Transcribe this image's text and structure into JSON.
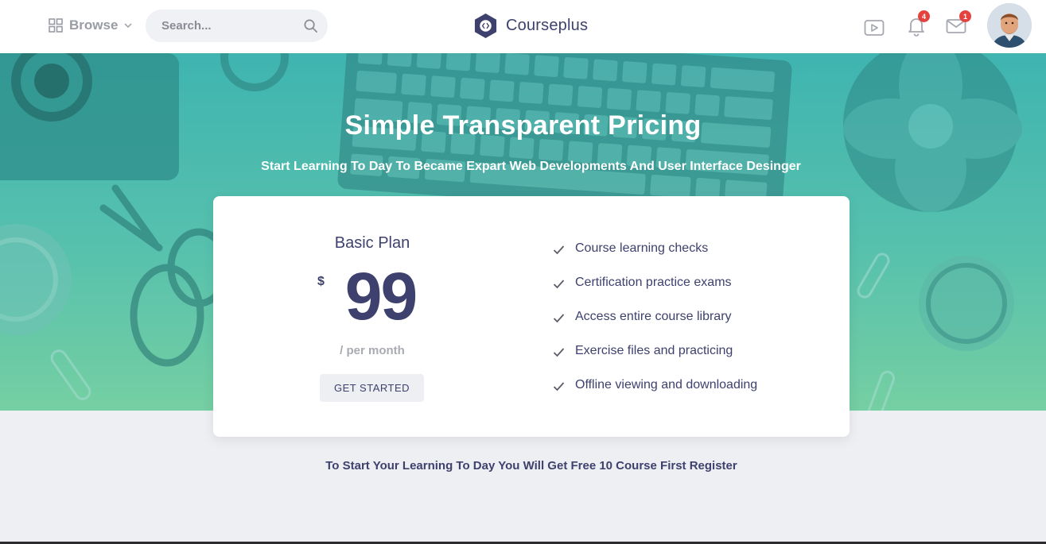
{
  "header": {
    "browse_label": "Browse",
    "search_placeholder": "Search...",
    "brand": "Courseplus",
    "notifications_count": "4",
    "messages_count": "1",
    "icons": [
      "grid-icon",
      "chevron-down-icon",
      "search-icon",
      "video-icon",
      "bell-icon",
      "mail-icon",
      "avatar"
    ]
  },
  "hero": {
    "title": "Simple Transparent Pricing",
    "subtitle": "Start Learning To Day To Became Expart Web Developments And User Interface Desinger"
  },
  "plan": {
    "name": "Basic Plan",
    "currency": "$",
    "price": "99",
    "period": "/ per month",
    "cta_label": "GET STARTED",
    "features": [
      "Course learning checks",
      "Certification practice exams",
      "Access entire course library",
      "Exercise files and practicing",
      "Offline viewing and downloading"
    ]
  },
  "footer_note": "To Start Your Learning To Day You Will Get Free 10 Course First Register",
  "colors": {
    "primary": "#3e416d",
    "hero_top": "#3fb4b0",
    "hero_bottom": "#75cfa2",
    "badge": "#e5423f",
    "page_bg": "#eeeff2"
  }
}
